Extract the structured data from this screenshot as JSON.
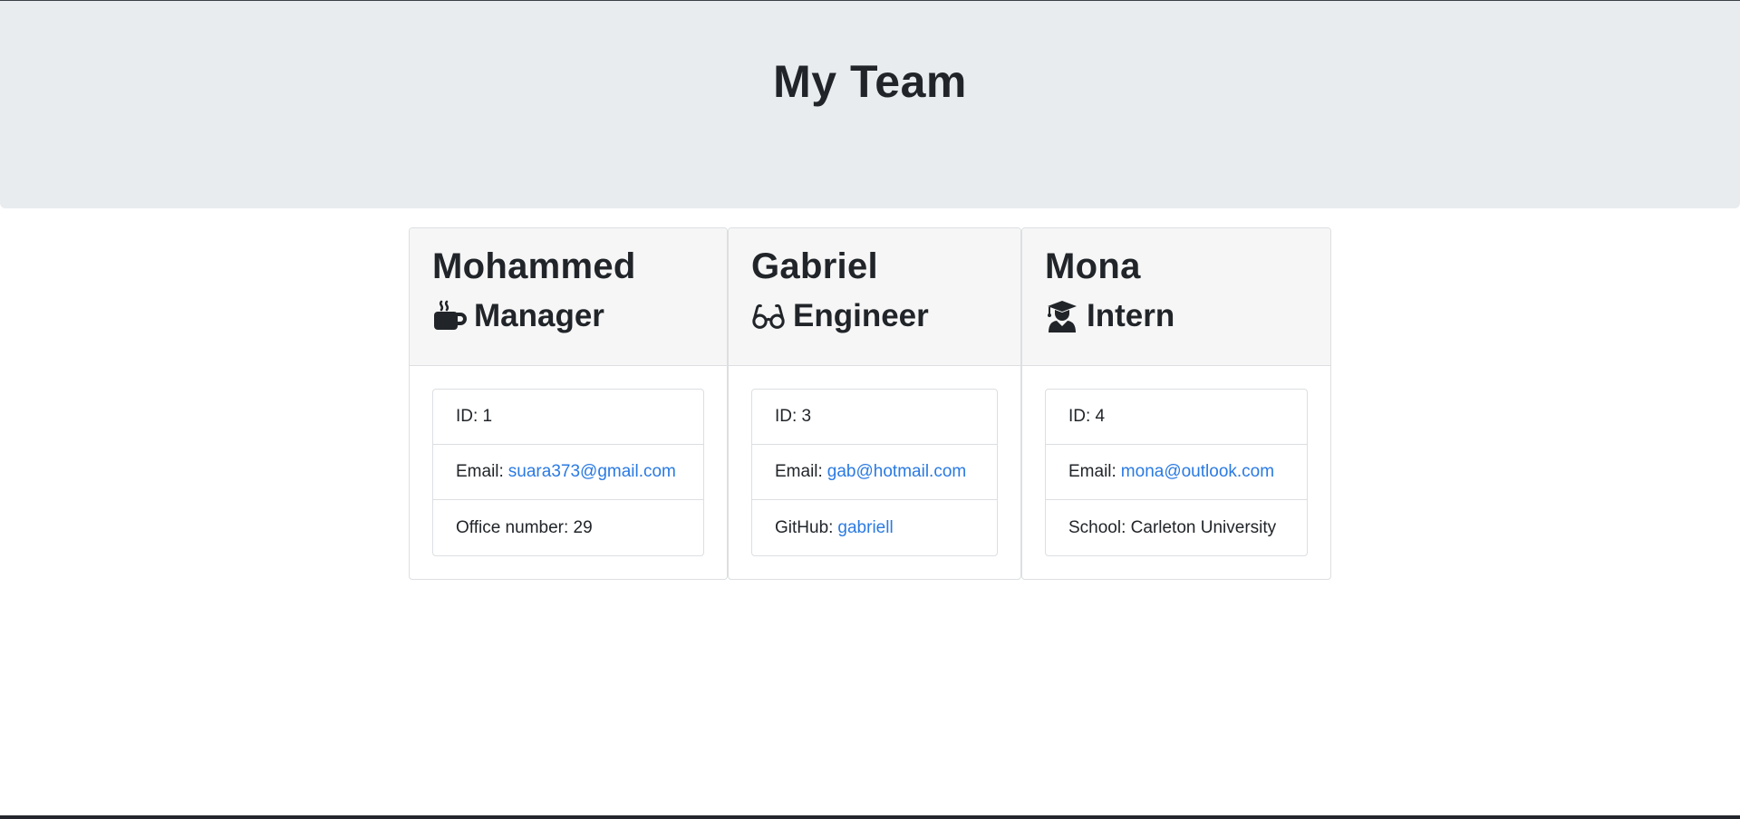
{
  "header": {
    "title": "My Team"
  },
  "team": [
    {
      "name": "Mohammed",
      "role": "Manager",
      "role_icon": "coffee-icon",
      "id_label": "ID: 1",
      "email_label": "Email:",
      "email": "suara373@gmail.com",
      "extra_label": "Office number: 29",
      "extra_value": ""
    },
    {
      "name": "Gabriel",
      "role": "Engineer",
      "role_icon": "glasses-icon",
      "id_label": "ID: 3",
      "email_label": "Email:",
      "email": "gab@hotmail.com",
      "extra_label": "GitHub:",
      "extra_value": "gabriell"
    },
    {
      "name": "Mona",
      "role": "Intern",
      "role_icon": "graduate-icon",
      "id_label": "ID: 4",
      "email_label": "Email:",
      "email": "mona@outlook.com",
      "extra_label": "School: Carleton University",
      "extra_value": ""
    }
  ],
  "colors": {
    "header_bg": "#e9ecef",
    "card_header_bg": "#f6f6f6",
    "link": "#2a7ae2",
    "text": "#212529"
  }
}
